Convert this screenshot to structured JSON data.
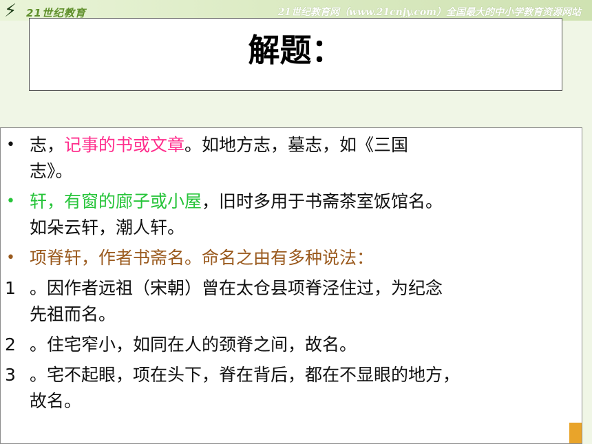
{
  "header": {
    "logo_text": "21世纪教育",
    "site_caption": "21世纪教育网（www.21cnjy.com）全国最大的中小学教育资源网站"
  },
  "title": "解题：",
  "items": [
    {
      "marker": "•",
      "parts": [
        {
          "text": "志，",
          "color": "#111111"
        },
        {
          "text": "记事的书或文章",
          "color": "#ff2d8c"
        },
        {
          "text": "。如地方志，墓志，如《三国",
          "color": "#111111"
        }
      ],
      "cont": "志》。"
    },
    {
      "marker": "•",
      "parts": [
        {
          "text": "轩，有窗的廊子或小屋",
          "color": "#27c43a"
        },
        {
          "text": "，旧时多用于书斋茶室饭馆名。",
          "color": "#111111"
        }
      ],
      "cont": "如朵云轩，潮人轩。"
    },
    {
      "marker": "•",
      "parts": [
        {
          "text": "项脊轩，作者书斋名。命名之由有多种说法：",
          "color": "#9a5a1e"
        }
      ]
    },
    {
      "marker": "1",
      "parts": [
        {
          "text": "。因作者远祖（宋朝）曾在太仓县项脊泾住过，为纪念",
          "color": "#111111"
        }
      ],
      "cont": "先祖而名。"
    },
    {
      "marker": "2",
      "parts": [
        {
          "text": "。住宅窄小，如同在人的颈脊之间，故名。",
          "color": "#111111"
        }
      ]
    },
    {
      "marker": "3",
      "parts": [
        {
          "text": "。宅不起眼，项在头下，脊在背后，都在不显眼的地方，",
          "color": "#111111"
        }
      ],
      "cont": "故名。"
    }
  ]
}
